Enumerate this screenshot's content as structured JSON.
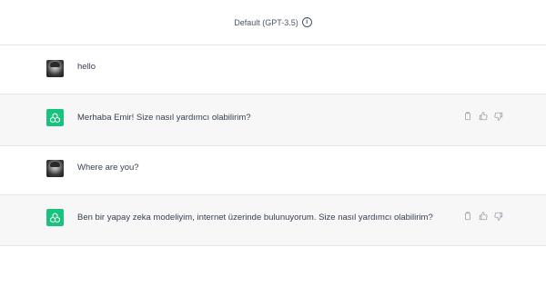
{
  "header": {
    "model_label": "Default (GPT-3.5)",
    "info_icon": "info-icon",
    "info_glyph": "i"
  },
  "messages": [
    {
      "role": "user",
      "text": "hello",
      "avatar": "user-avatar"
    },
    {
      "role": "assistant",
      "text": "Merhaba Emir! Size nasıl yardımcı olabilirim?",
      "avatar": "chatgpt-logo-icon",
      "actions": [
        "copy-icon",
        "thumbs-up-icon",
        "thumbs-down-icon"
      ]
    },
    {
      "role": "user",
      "text": "Where are you?",
      "avatar": "user-avatar"
    },
    {
      "role": "assistant",
      "text": "Ben bir yapay zeka modeliyim, internet üzerinde bulunuyorum. Size nasıl yardımcı olabilirim?",
      "avatar": "chatgpt-logo-icon",
      "actions": [
        "copy-icon",
        "thumbs-up-icon",
        "thumbs-down-icon"
      ]
    }
  ],
  "colors": {
    "assistant_bg": "#f7f7f8",
    "openai_green": "#19c37d",
    "border": "#e5e7eb",
    "text": "#374151"
  }
}
